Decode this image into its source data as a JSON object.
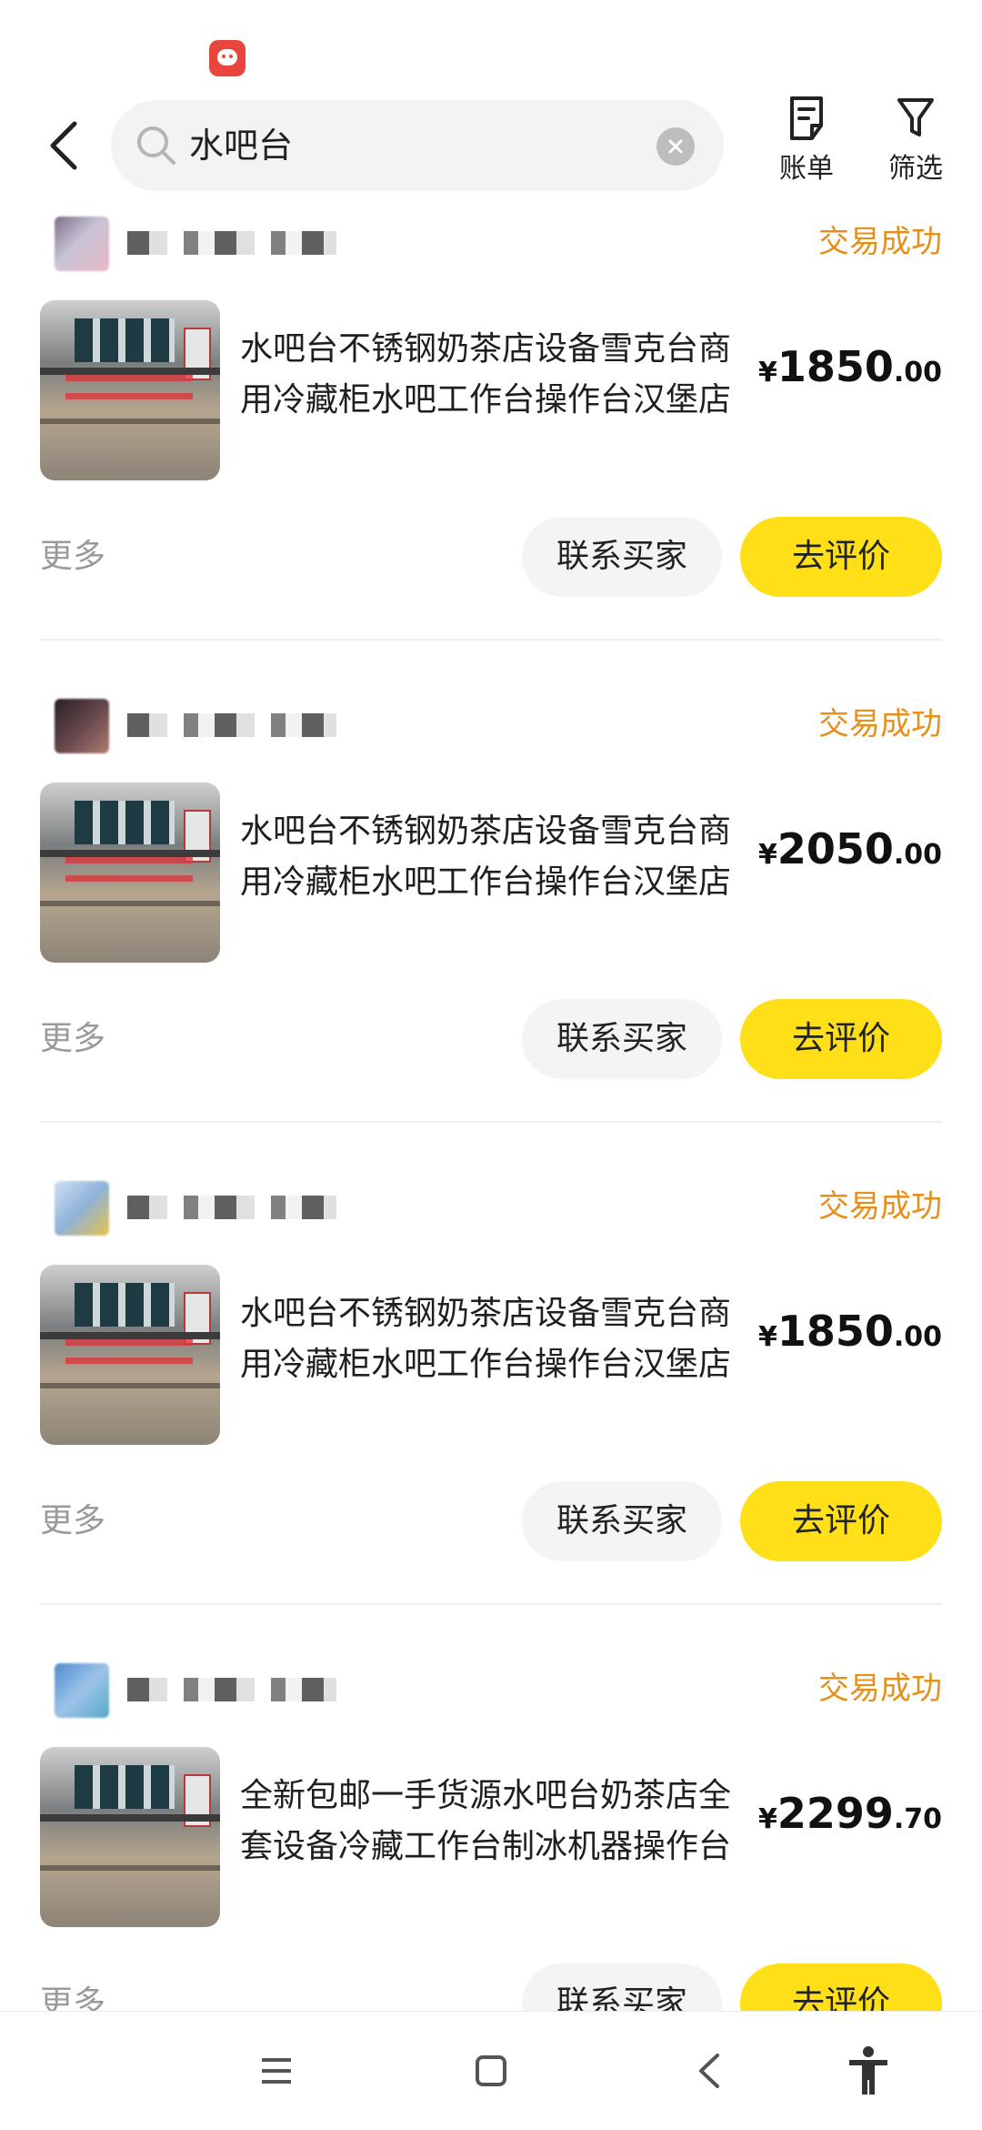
{
  "search": {
    "query": "水吧台"
  },
  "top_actions": {
    "bill_label": "账单",
    "filter_label": "筛选"
  },
  "orders": [
    {
      "status": "交易成功",
      "title": "水吧台不锈钢奶茶店设备雪克台商用冷藏柜水吧工作台操作台汉堡店",
      "price_symbol": "¥",
      "price_int": "1850",
      "price_dec": ".00",
      "more": "更多",
      "contact": "联系买家",
      "review": "去评价"
    },
    {
      "status": "交易成功",
      "title": "水吧台不锈钢奶茶店设备雪克台商用冷藏柜水吧工作台操作台汉堡店",
      "price_symbol": "¥",
      "price_int": "2050",
      "price_dec": ".00",
      "more": "更多",
      "contact": "联系买家",
      "review": "去评价"
    },
    {
      "status": "交易成功",
      "title": "水吧台不锈钢奶茶店设备雪克台商用冷藏柜水吧工作台操作台汉堡店",
      "price_symbol": "¥",
      "price_int": "1850",
      "price_dec": ".00",
      "more": "更多",
      "contact": "联系买家",
      "review": "去评价"
    },
    {
      "status": "交易成功",
      "title": "全新包邮一手货源水吧台奶茶店全套设备冷藏工作台制冰机器操作台",
      "price_symbol": "¥",
      "price_int": "2299",
      "price_dec": ".70",
      "more": "更多",
      "contact": "联系买家",
      "review": "去评价"
    }
  ],
  "colors": {
    "accent_yellow": "#ffe018",
    "status_orange": "#e6901b"
  },
  "icons": {
    "back": "chevron-left-icon",
    "search": "search-icon",
    "clear": "clear-icon",
    "bill": "bill-icon",
    "filter": "filter-icon",
    "nav_menu": "menu-icon",
    "nav_home": "home-icon",
    "nav_back": "back-icon",
    "nav_accessibility": "accessibility-icon"
  }
}
